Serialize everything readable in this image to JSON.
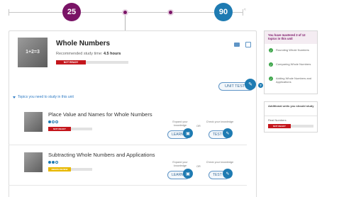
{
  "progress": {
    "start_value": "25",
    "target_value": "90"
  },
  "unit": {
    "title": "Whole Numbers",
    "image_text": "1+2=3",
    "study_time_label": "Recommended study time:",
    "study_time_value": "4.5 hours",
    "status": "NOT READY",
    "unit_test_label": "UNIT TEST",
    "help": "?"
  },
  "topics_toggle": "Topics you need to study in this unit",
  "topics": [
    {
      "title": "Place Value and Names for Whole Numbers",
      "status": "NOT READY",
      "expand_caption": "Expand your knowledge",
      "or": "OR",
      "check_caption": "Check your knowledge",
      "learn_label": "LEARN",
      "test_label": "TEST"
    },
    {
      "title": "Subtracting Whole Numbers and Applications",
      "status": "NEEDS REVIEW",
      "expand_caption": "Expand your knowledge",
      "or": "OR",
      "check_caption": "Check your knowledge",
      "learn_label": "LEARN",
      "test_label": "TEST"
    }
  ],
  "mastery": {
    "header": "You have mastered 3 of 12 topics in this unit",
    "items": [
      "Rounding Whole Numbers",
      "Comparing Whole Numbers",
      "Adding Whole Numbers and Applications"
    ]
  },
  "additional": {
    "header": "Additional units you should study",
    "item": "Real Numbers",
    "status": "NOT READY"
  },
  "colors": {
    "brand_purple": "#7a1466",
    "brand_blue": "#1e7bb2",
    "not_ready_red": "#c4161c",
    "needs_review_yellow": "#e8b800",
    "mastered_green": "#3fa64c"
  },
  "icons": [
    "mail-icon",
    "print-icon",
    "pencil-icon",
    "check-icon",
    "triangle-down-icon",
    "help-icon"
  ]
}
